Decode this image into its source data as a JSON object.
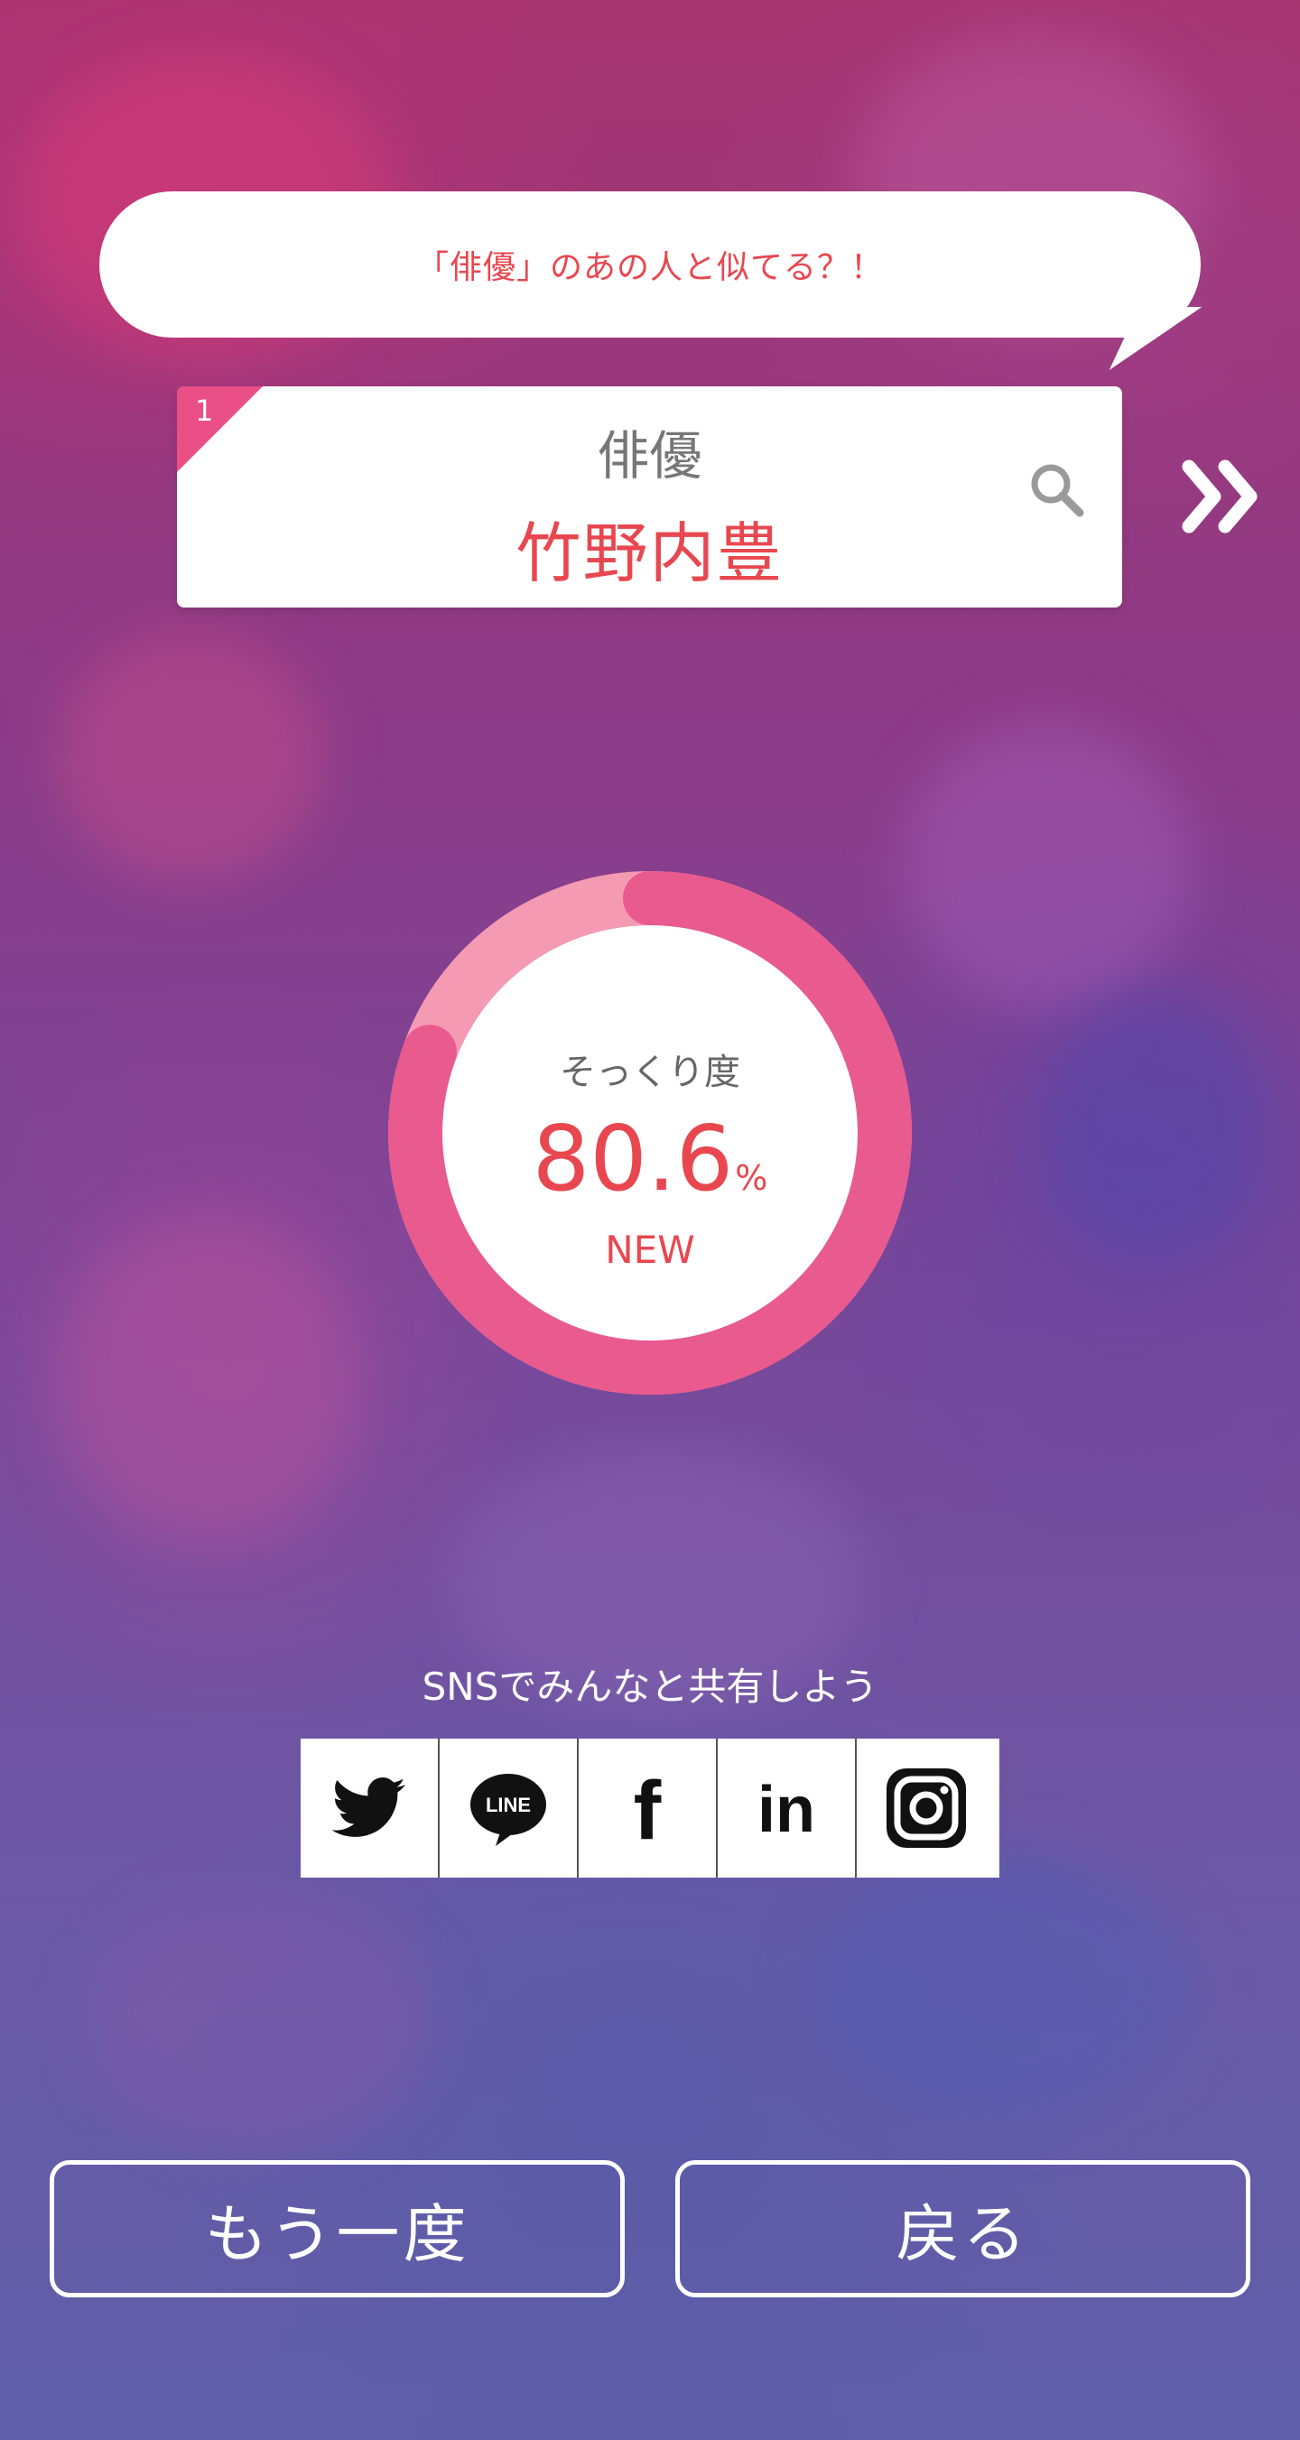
{
  "bubble": {
    "text": "「俳優」のあの人と似てる？！"
  },
  "result": {
    "rank": "1",
    "category": "俳優",
    "name": "竹野内豊"
  },
  "similarity": {
    "label": "そっくり度",
    "value": "80.6",
    "unit": "%",
    "badge": "NEW",
    "fraction": 0.806
  },
  "share": {
    "label": "SNSでみんなと共有しよう",
    "services": [
      {
        "name": "twitter-icon"
      },
      {
        "name": "line-icon",
        "text": "LINE"
      },
      {
        "name": "facebook-icon",
        "text": "f"
      },
      {
        "name": "linkedin-icon",
        "text": "in"
      },
      {
        "name": "instagram-icon"
      }
    ]
  },
  "buttons": {
    "retry": "もう一度",
    "back": "戻る"
  },
  "colors": {
    "accent_red": "#e8474f",
    "accent_pink": "#e95a8f",
    "ring_light_pink": "#f59ab3"
  }
}
